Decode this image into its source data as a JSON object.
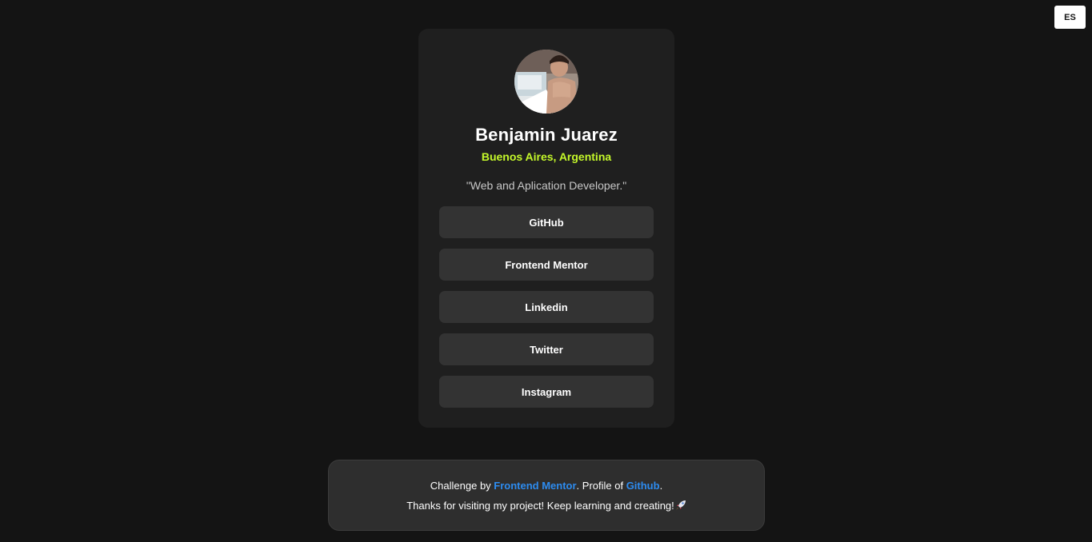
{
  "language_toggle": {
    "label": "ES"
  },
  "profile": {
    "avatar_icon": "profile-photo",
    "name": "Benjamin Juarez",
    "location": "Buenos Aires, Argentina",
    "bio": "\"Web and Aplication Developer.\""
  },
  "links": [
    {
      "label": "GitHub"
    },
    {
      "label": "Frontend Mentor"
    },
    {
      "label": "Linkedin"
    },
    {
      "label": "Twitter"
    },
    {
      "label": "Instagram"
    }
  ],
  "footer": {
    "line1_prefix": "Challenge by ",
    "challenge_link": "Frontend Mentor",
    "line1_middle": ". Profile of ",
    "profile_link": "Github",
    "line1_suffix": ".",
    "line2": "Thanks for visiting my project! Keep learning and creating!",
    "line2_icon": "rocket-icon"
  },
  "colors": {
    "background": "#141414",
    "card": "#1f1f1f",
    "button": "#333333",
    "accent": "#c4f82a",
    "link": "#2d8cf0"
  }
}
